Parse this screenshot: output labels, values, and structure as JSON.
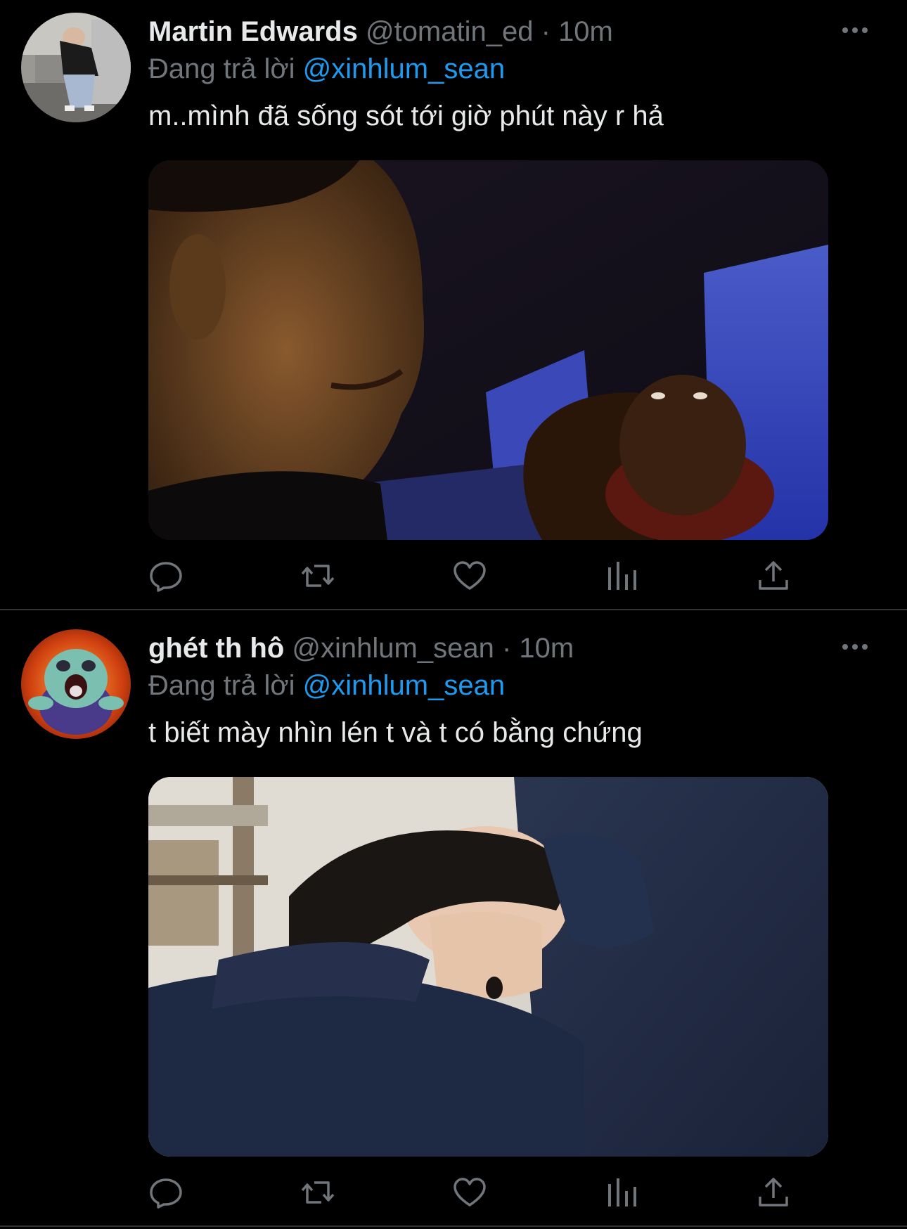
{
  "tweets": [
    {
      "name": "Martin Edwards",
      "handle": "@tomatin_ed",
      "separator": "·",
      "time": "10m",
      "reply_prefix": "Đang trả lời",
      "reply_to": "@xinhlum_sean",
      "text": "m..mình đã sống sót tới giờ phút này r hả"
    },
    {
      "name": "ghét th hô",
      "handle": "@xinhlum_sean",
      "separator": "·",
      "time": "10m",
      "reply_prefix": "Đang trả lời",
      "reply_to": "@xinhlum_sean",
      "text": "t biết mày nhìn lén t và t có bằng chứng"
    }
  ],
  "icons": {
    "more": "more-horizontal-icon",
    "reply": "reply-bubble-icon",
    "retweet": "retweet-icon",
    "like": "heart-icon",
    "views": "analytics-bars-icon",
    "share": "share-upload-icon"
  },
  "colors": {
    "background": "#000000",
    "text": "#e7e9ea",
    "muted": "#71767b",
    "accent": "#1d9bf0",
    "divider": "#2f3336"
  }
}
